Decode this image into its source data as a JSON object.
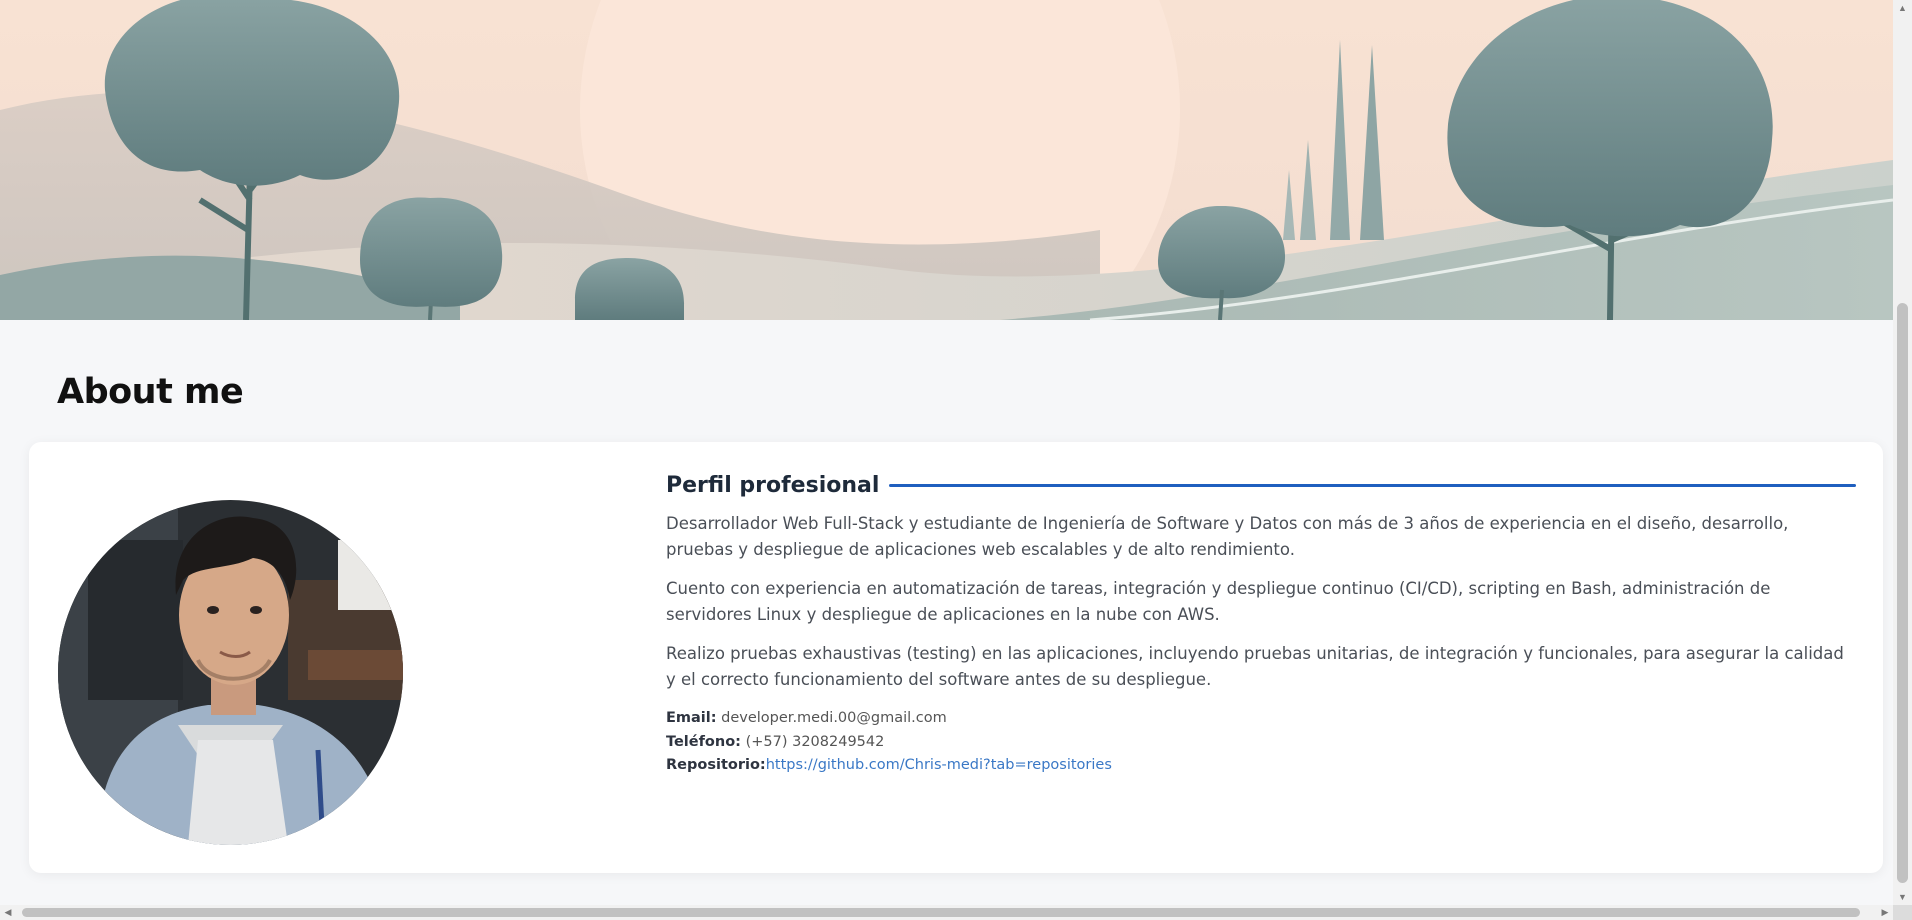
{
  "about": {
    "heading": "About me"
  },
  "profile": {
    "section_title": "Perfil profesional",
    "paragraphs": [
      "Desarrollador Web Full-Stack y estudiante de Ingeniería de Software y Datos con más de 3 años de experiencia en el diseño, desarrollo, pruebas y despliegue de aplicaciones web escalables y de alto rendimiento.",
      "Cuento con experiencia en automatización de tareas, integración y despliegue continuo (CI/CD), scripting en Bash, administración de servidores Linux y despliegue de aplicaciones en la nube con AWS.",
      "Realizo pruebas exhaustivas (testing) en las aplicaciones, incluyendo pruebas unitarias, de integración y funcionales, para asegurar la calidad y el correcto funcionamiento del software antes de su despliegue."
    ],
    "contact": {
      "email_label": "Email:",
      "email_value": "developer.medi.00@gmail.com",
      "phone_label": "Teléfono:",
      "phone_value": "(+57) 3208249542",
      "repo_label": "Repositorio:",
      "repo_value": "https://github.com/Chris-medi?tab=repositories"
    }
  },
  "icons": {
    "scroll_up": "▲",
    "scroll_down": "▼",
    "scroll_left": "◀",
    "scroll_right": "▶"
  },
  "colors": {
    "accent": "#1f5fbf",
    "link": "#3a78c6",
    "page_background": "#f6f7f9"
  }
}
